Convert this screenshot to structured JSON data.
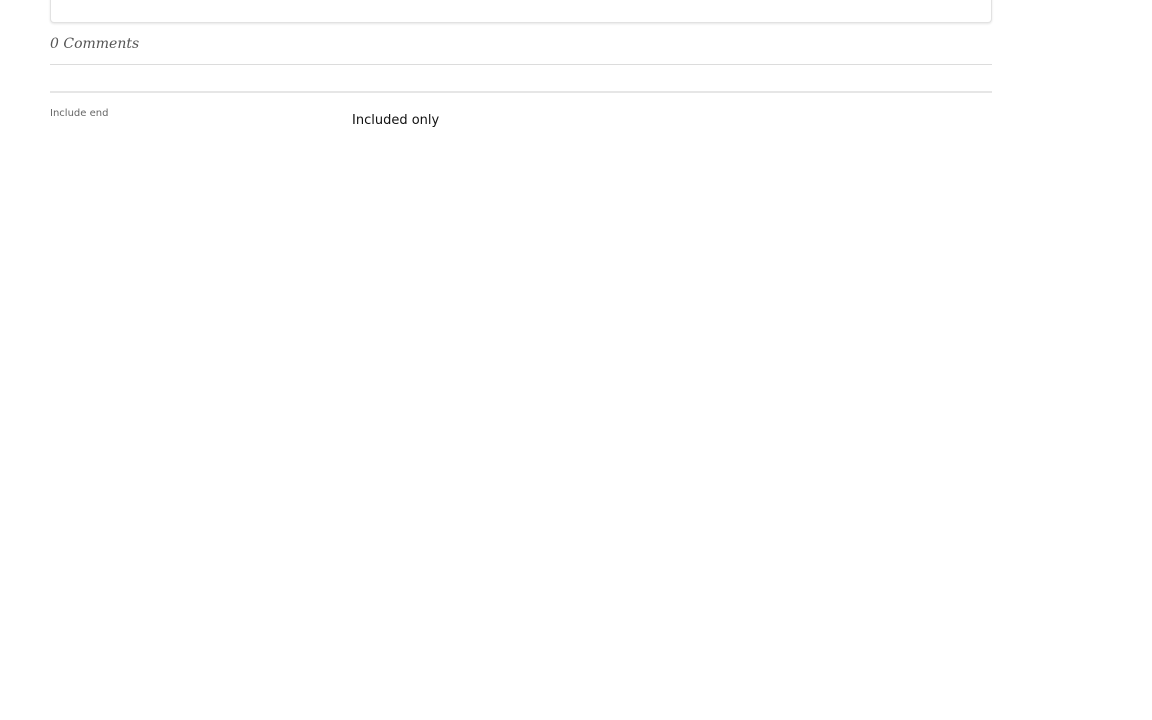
{
  "comments": {
    "count_label": "0 Comments"
  },
  "footer": {
    "include_end_label": "Include end",
    "included_only_label": "Included only"
  }
}
